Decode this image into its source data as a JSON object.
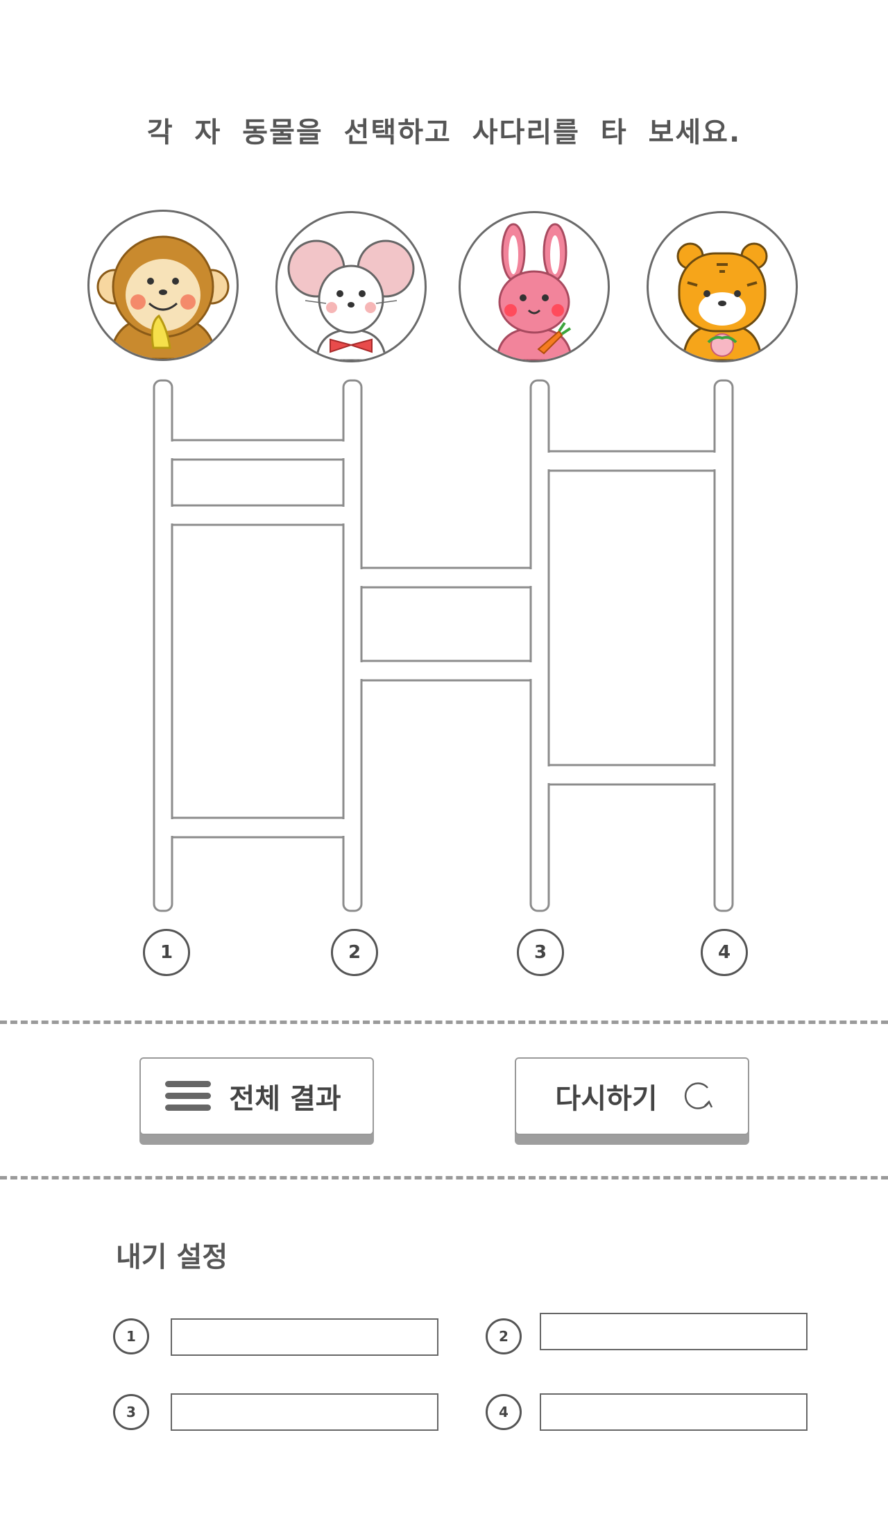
{
  "title": "각 자 동물을 선택하고 사다리를 타 보세요.",
  "animals": [
    {
      "name": "monkey",
      "icon": "monkey-icon"
    },
    {
      "name": "mouse",
      "icon": "mouse-icon"
    },
    {
      "name": "rabbit",
      "icon": "rabbit-icon"
    },
    {
      "name": "tiger",
      "icon": "tiger-icon"
    }
  ],
  "ladder_numbers": [
    "1",
    "2",
    "3",
    "4"
  ],
  "buttons": {
    "results_label": "전체 결과",
    "results_icon": "menu-icon",
    "retry_label": "다시하기",
    "retry_icon": "refresh-icon"
  },
  "settings": {
    "title": "내기 설정",
    "numbers": [
      "1",
      "2",
      "3",
      "4"
    ],
    "values": [
      "",
      "",
      "",
      ""
    ]
  },
  "colors": {
    "text": "#555555",
    "outline": "#9a9a9a",
    "button_shadow": "#9e9e9e"
  }
}
